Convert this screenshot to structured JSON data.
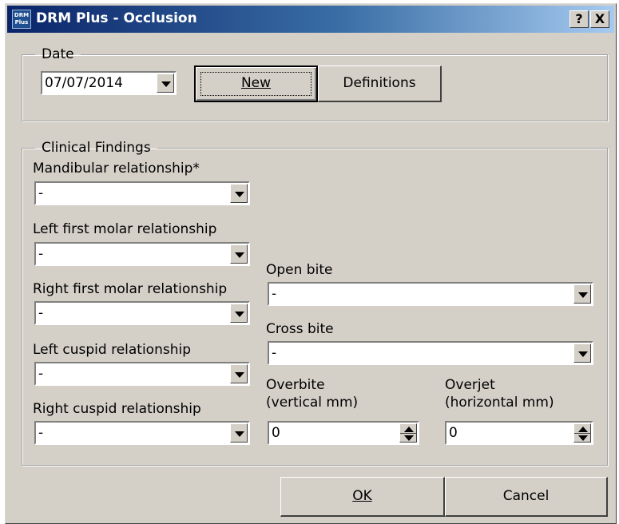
{
  "window": {
    "title": "DRM Plus - Occlusion",
    "app_icon_text_1": "DRM",
    "app_icon_text_2": "Plus",
    "help_label": "?",
    "close_label": "X"
  },
  "date_group": {
    "legend": "Date",
    "date_value": "07/07/2014",
    "new_label": "New",
    "definitions_label": "Definitions"
  },
  "clinical": {
    "legend": "Clinical Findings",
    "mandibular": {
      "label": "Mandibular relationship*",
      "value": "-"
    },
    "left_molar": {
      "label": "Left first molar relationship",
      "value": "-"
    },
    "right_molar": {
      "label": "Right first molar relationship",
      "value": "-"
    },
    "left_cuspid": {
      "label": "Left cuspid relationship",
      "value": "-"
    },
    "right_cuspid": {
      "label": "Right cuspid relationship",
      "value": "-"
    },
    "open_bite": {
      "label": "Open bite",
      "value": "-"
    },
    "cross_bite": {
      "label": "Cross bite",
      "value": "-"
    },
    "overbite": {
      "label_1": "Overbite",
      "label_2": "(vertical mm)",
      "value": "0"
    },
    "overjet": {
      "label_1": "Overjet",
      "label_2": "(horizontal mm)",
      "value": "0"
    }
  },
  "buttons": {
    "ok_label": "OK",
    "cancel_label": "Cancel"
  },
  "colors": {
    "face": "#d4d0c8",
    "title_start": "#0a246a",
    "title_end": "#a6caf0"
  }
}
